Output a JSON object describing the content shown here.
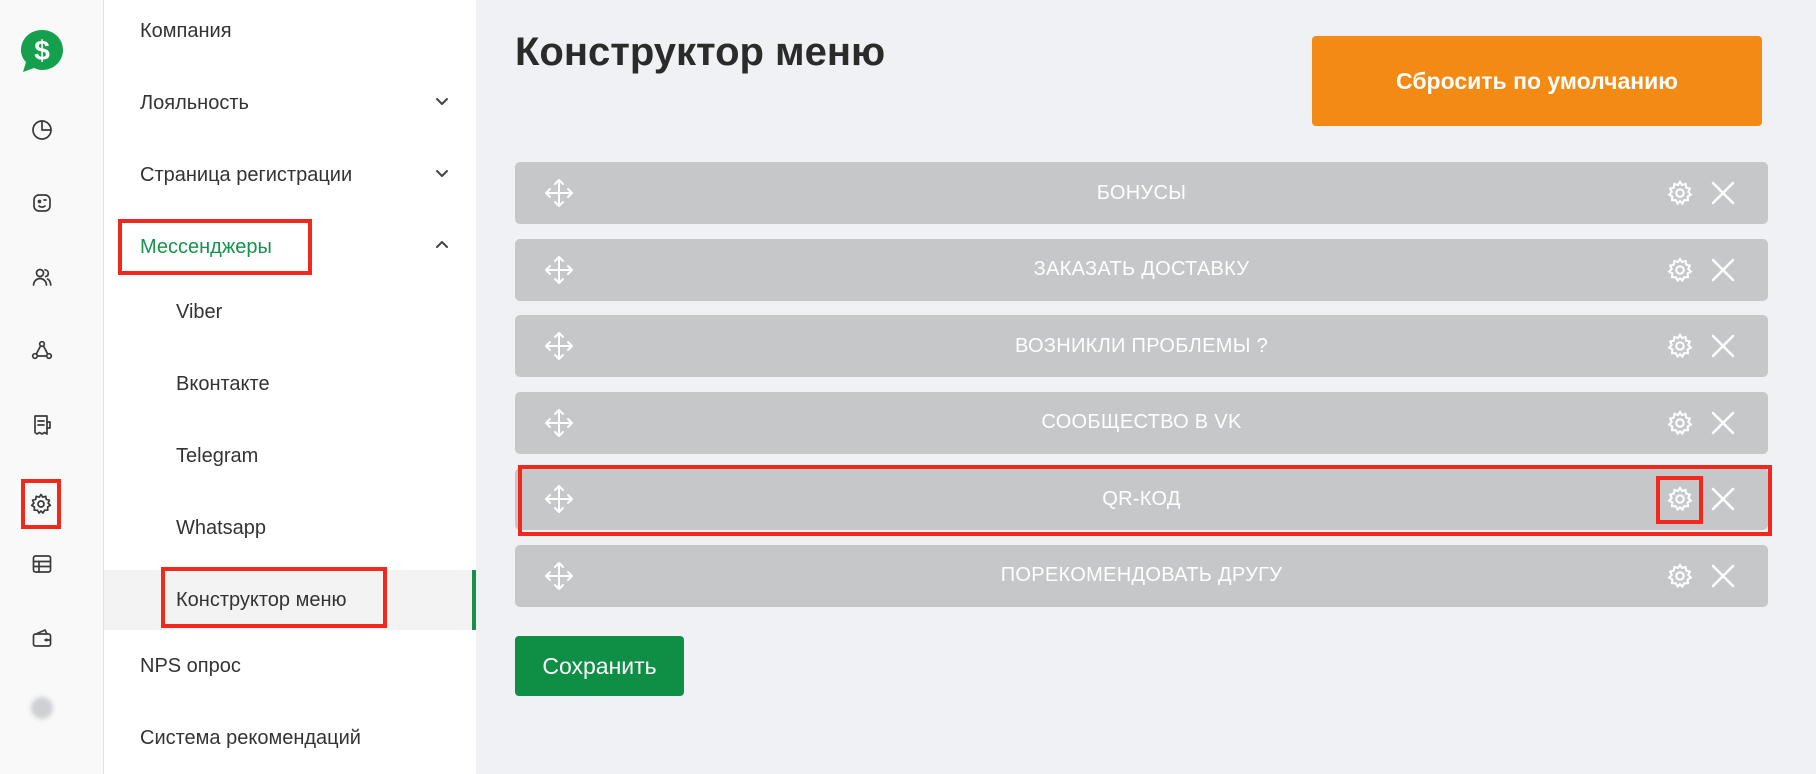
{
  "brand": {
    "logo_icon": "dollar-chat-logo",
    "accent": "#0f8f46"
  },
  "rail": {
    "icons": [
      "dashboard-icon",
      "chat-bot-icon",
      "users-icon",
      "network-icon",
      "receipt-icon",
      "gear-icon",
      "table-icon",
      "wallet-icon"
    ]
  },
  "submenu": {
    "company": "Компания",
    "loyalty": "Лояльность",
    "registration": "Страница регистрации",
    "messengers": "Мессенджеры",
    "viber": "Viber",
    "vkontakte": "Вконтакте",
    "telegram": "Telegram",
    "whatsapp": "Whatsapp",
    "menu_builder": "Конструктор меню",
    "nps": "NPS опрос",
    "referral": "Система рекомендаций"
  },
  "main": {
    "title": "Конструктор меню",
    "reset_label": "Сбросить по умолчанию",
    "save_label": "Сохранить",
    "menu_items": [
      {
        "label": "БОНУСЫ"
      },
      {
        "label": "ЗАКАЗАТЬ ДОСТАВКУ"
      },
      {
        "label": "ВОЗНИКЛИ ПРОБЛЕМЫ ?"
      },
      {
        "label": "СООБЩЕСТВО В VK"
      },
      {
        "label": "QR-КОД"
      },
      {
        "label": "ПОРЕКОМЕНДОВАТЬ ДРУГУ"
      }
    ]
  },
  "colors": {
    "highlight": "#f0281e",
    "reset_button": "#f28a13",
    "save_button": "#0f8f46",
    "menu_row": "#c6c7c8",
    "active_text": "#14944c"
  }
}
